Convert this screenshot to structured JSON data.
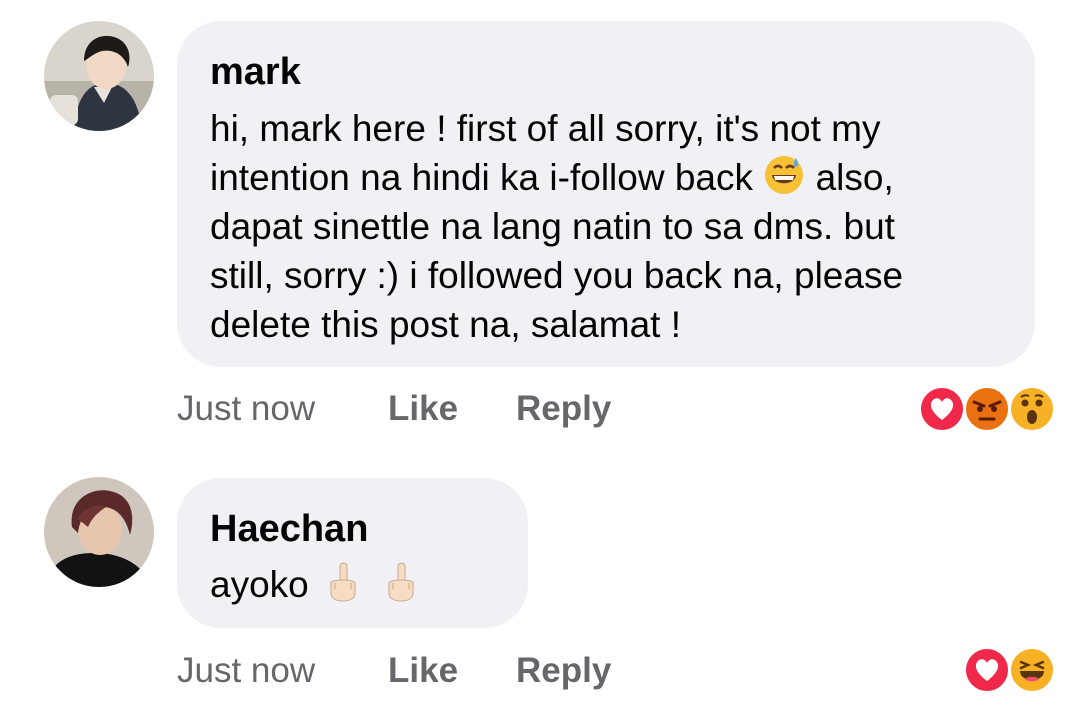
{
  "comments": [
    {
      "author": "mark",
      "avatar_icon": "avatar-photo-icon",
      "lines": [
        "hi, mark here ! first of all sorry, it's not my",
        "intention na hindi ka i-follow back",
        "also,",
        "dapat sinettle na lang natin to sa dms. but",
        "still, sorry :) i followed you back na, please",
        "delete this post na, salamat !"
      ],
      "inline_emoji": "grinning-sweat-emoji",
      "timestamp": "Just now",
      "like_label": "Like",
      "reply_label": "Reply",
      "reactions": [
        "love-reaction-icon",
        "angry-reaction-icon",
        "wow-reaction-icon"
      ]
    },
    {
      "author": "Haechan",
      "avatar_icon": "avatar-photo-icon",
      "text": "ayoko",
      "inline_emojis": [
        "middle-finger-emoji",
        "middle-finger-emoji"
      ],
      "timestamp": "Just now",
      "like_label": "Like",
      "reply_label": "Reply",
      "reactions": [
        "love-reaction-icon",
        "haha-reaction-icon"
      ]
    }
  ],
  "colors": {
    "bubble": "#f0f0f5",
    "meta_text": "#65676b",
    "love": "#f0284a",
    "angry": "#e9710f",
    "wow": "#f7b125"
  }
}
